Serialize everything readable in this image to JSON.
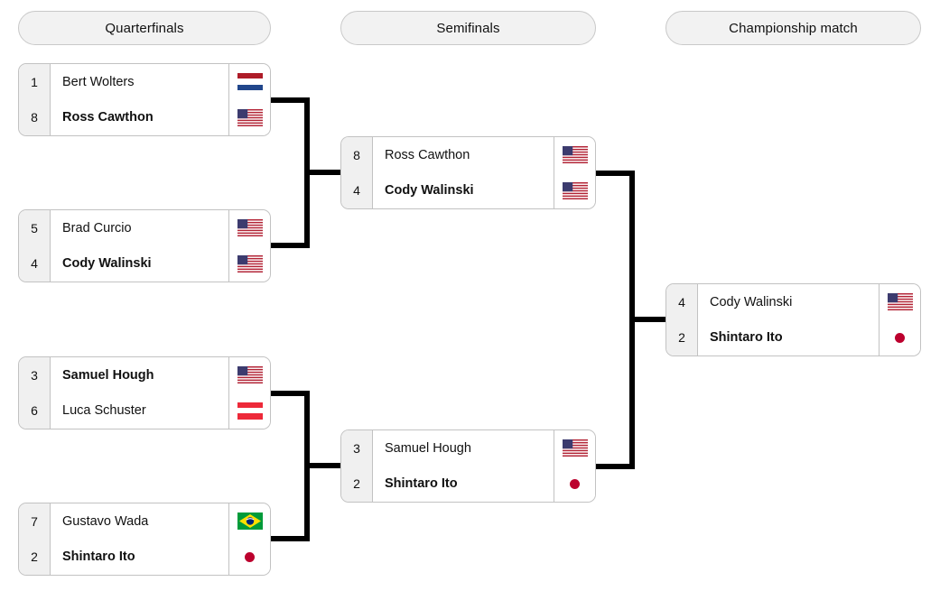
{
  "rounds": [
    {
      "id": "quarterfinals",
      "label": "Quarterfinals"
    },
    {
      "id": "semifinals",
      "label": "Semifinals"
    },
    {
      "id": "championship",
      "label": "Championship match"
    }
  ],
  "matches": {
    "qf1": {
      "top": {
        "seed": "1",
        "name": "Bert Wolters",
        "flag": "nl",
        "flag_name": "netherlands-flag",
        "winner": false
      },
      "bottom": {
        "seed": "8",
        "name": "Ross Cawthon",
        "flag": "us",
        "flag_name": "united-states-flag",
        "winner": true
      }
    },
    "qf2": {
      "top": {
        "seed": "5",
        "name": "Brad Curcio",
        "flag": "us",
        "flag_name": "united-states-flag",
        "winner": false
      },
      "bottom": {
        "seed": "4",
        "name": "Cody Walinski",
        "flag": "us",
        "flag_name": "united-states-flag",
        "winner": true
      }
    },
    "qf3": {
      "top": {
        "seed": "3",
        "name": "Samuel Hough",
        "flag": "us",
        "flag_name": "united-states-flag",
        "winner": true
      },
      "bottom": {
        "seed": "6",
        "name": "Luca Schuster",
        "flag": "at",
        "flag_name": "austria-flag",
        "winner": false
      }
    },
    "qf4": {
      "top": {
        "seed": "7",
        "name": "Gustavo Wada",
        "flag": "br",
        "flag_name": "brazil-flag",
        "winner": false
      },
      "bottom": {
        "seed": "2",
        "name": "Shintaro Ito",
        "flag": "jp",
        "flag_name": "japan-flag",
        "winner": true
      }
    },
    "sf1": {
      "top": {
        "seed": "8",
        "name": "Ross Cawthon",
        "flag": "us",
        "flag_name": "united-states-flag",
        "winner": false
      },
      "bottom": {
        "seed": "4",
        "name": "Cody Walinski",
        "flag": "us",
        "flag_name": "united-states-flag",
        "winner": true
      }
    },
    "sf2": {
      "top": {
        "seed": "3",
        "name": "Samuel Hough",
        "flag": "us",
        "flag_name": "united-states-flag",
        "winner": false
      },
      "bottom": {
        "seed": "2",
        "name": "Shintaro Ito",
        "flag": "jp",
        "flag_name": "japan-flag",
        "winner": true
      }
    },
    "final": {
      "top": {
        "seed": "4",
        "name": "Cody Walinski",
        "flag": "us",
        "flag_name": "united-states-flag",
        "winner": false
      },
      "bottom": {
        "seed": "2",
        "name": "Shintaro Ito",
        "flag": "jp",
        "flag_name": "japan-flag",
        "winner": true
      }
    }
  },
  "colors": {
    "line": "#000000",
    "box_border": "#c2c2c2",
    "seed_bg": "#f0f0f0",
    "header_bg": "#f2f2f2",
    "netherlands_red": "#ae1c28",
    "netherlands_blue": "#21468b",
    "austria_red": "#ed2939",
    "japan_red": "#bc002d",
    "brazil_green": "#009b3a",
    "brazil_yellow": "#fedf00",
    "brazil_blue": "#002776",
    "usa_red": "#b22234",
    "usa_blue": "#3c3b6e"
  }
}
